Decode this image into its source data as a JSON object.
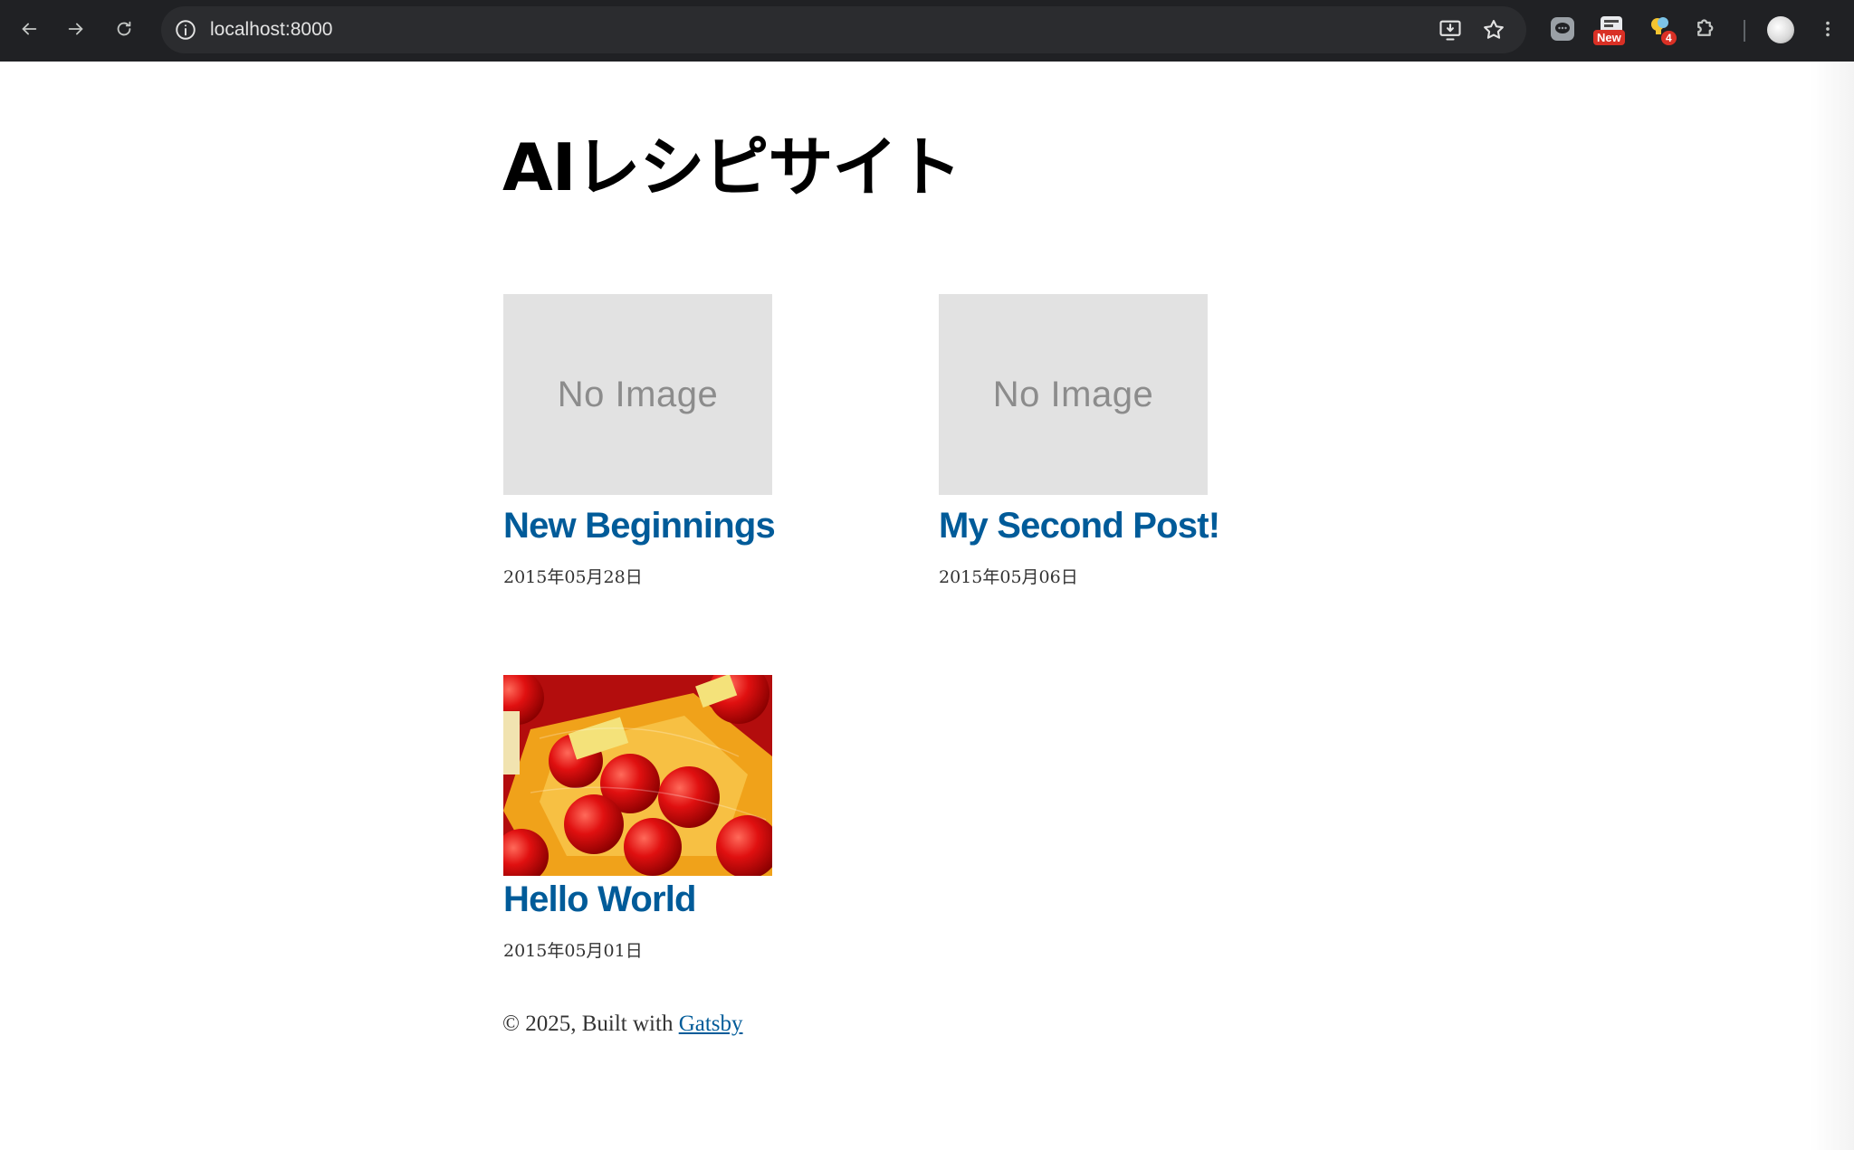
{
  "browser": {
    "url": "localhost:8000",
    "nav_icons": [
      "back-arrow-icon",
      "forward-arrow-icon",
      "reload-icon"
    ],
    "extensions": [
      {
        "icon": "chat-icon",
        "badge": ""
      },
      {
        "icon": "extension-icon",
        "badge": "New"
      },
      {
        "icon": "bulb-icon",
        "badge": "4"
      },
      {
        "icon": "puzzle-icon",
        "badge": ""
      }
    ],
    "badge_color": "#d93025"
  },
  "site": {
    "title": "AIレシピサイト",
    "link_color": "#005b99"
  },
  "posts": [
    {
      "title": "New Beginnings",
      "date": "2015年05月28日",
      "image_alt": "No Image",
      "has_image": false
    },
    {
      "title": "My Second Post!",
      "date": "2015年05月06日",
      "image_alt": "No Image",
      "has_image": false
    },
    {
      "title": "Hello World",
      "date": "2015年05月01日",
      "image_alt": "",
      "has_image": true
    }
  ],
  "footer": {
    "prefix": "© 2025, Built with ",
    "link_text": "Gatsby"
  }
}
